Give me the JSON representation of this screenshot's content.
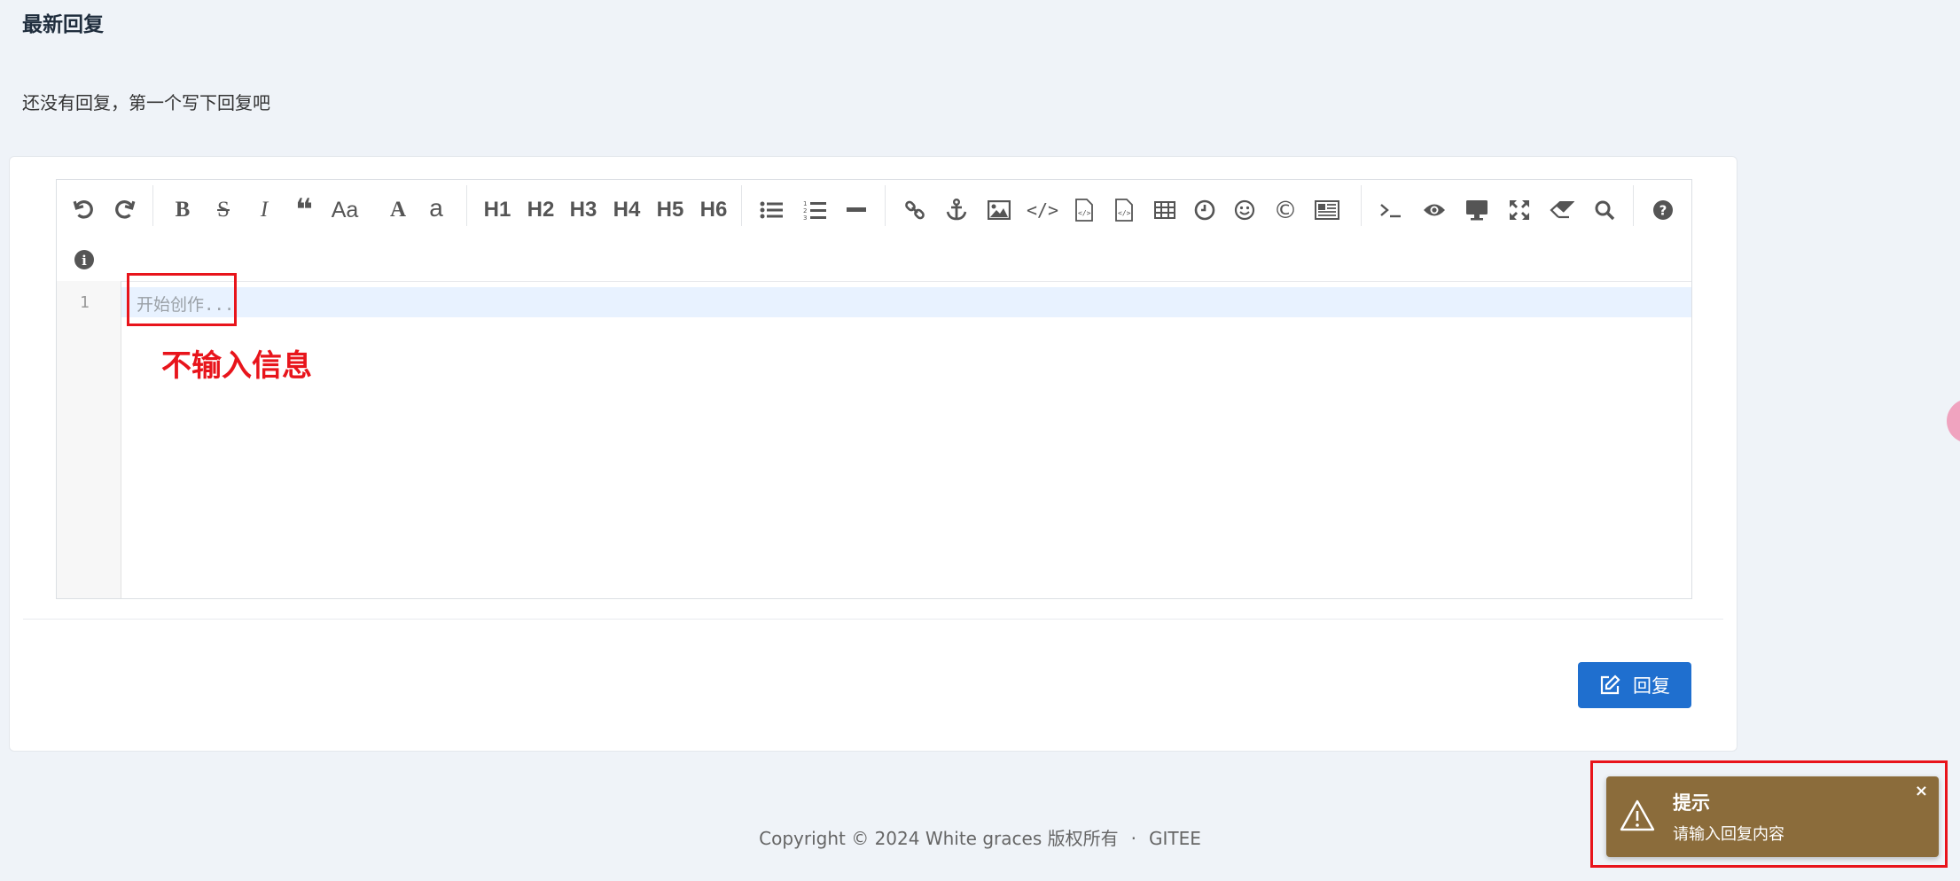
{
  "section": {
    "title": "最新回复",
    "empty_text": "还没有回复，第一个写下回复吧"
  },
  "toolbar": {
    "buttons": [
      {
        "name": "undo-icon"
      },
      {
        "name": "redo-icon"
      },
      {
        "name": "bold-icon",
        "label": "B"
      },
      {
        "name": "strikethrough-icon",
        "label": "S"
      },
      {
        "name": "italic-icon",
        "label": "I"
      },
      {
        "name": "quote-icon",
        "label": "❝"
      },
      {
        "name": "case-icon",
        "label": "Aa"
      },
      {
        "name": "uppercase-icon",
        "label": "A"
      },
      {
        "name": "lowercase-icon",
        "label": "a"
      },
      {
        "name": "h1-button",
        "label": "H1"
      },
      {
        "name": "h2-button",
        "label": "H2"
      },
      {
        "name": "h3-button",
        "label": "H3"
      },
      {
        "name": "h4-button",
        "label": "H4"
      },
      {
        "name": "h5-button",
        "label": "H5"
      },
      {
        "name": "h6-button",
        "label": "H6"
      },
      {
        "name": "unordered-list-icon"
      },
      {
        "name": "ordered-list-icon"
      },
      {
        "name": "horizontal-rule-icon"
      },
      {
        "name": "link-icon"
      },
      {
        "name": "anchor-icon"
      },
      {
        "name": "image-icon"
      },
      {
        "name": "inline-code-icon"
      },
      {
        "name": "code-block-icon"
      },
      {
        "name": "preformatted-text-icon"
      },
      {
        "name": "table-icon"
      },
      {
        "name": "datetime-icon"
      },
      {
        "name": "emoji-icon"
      },
      {
        "name": "html-entities-icon"
      },
      {
        "name": "pagebreak-icon"
      },
      {
        "name": "terminal-icon"
      },
      {
        "name": "watch-preview-icon"
      },
      {
        "name": "preview-icon"
      },
      {
        "name": "fullscreen-icon"
      },
      {
        "name": "clear-icon"
      },
      {
        "name": "search-icon"
      },
      {
        "name": "help-icon"
      },
      {
        "name": "info-icon"
      }
    ]
  },
  "editor": {
    "line_number": "1",
    "placeholder": "开始创作..."
  },
  "annotation": {
    "text": "不输入信息",
    "color": "#e8141b"
  },
  "reply_button": {
    "label": "回复",
    "color": "#1f6fcf"
  },
  "footer": {
    "copyright": "Copyright © 2024 White graces 版权所有",
    "separator": "·",
    "link": "GITEE"
  },
  "toast": {
    "title": "提示",
    "message": "请输入回复内容",
    "close": "×",
    "color": "#8b6c3b"
  }
}
